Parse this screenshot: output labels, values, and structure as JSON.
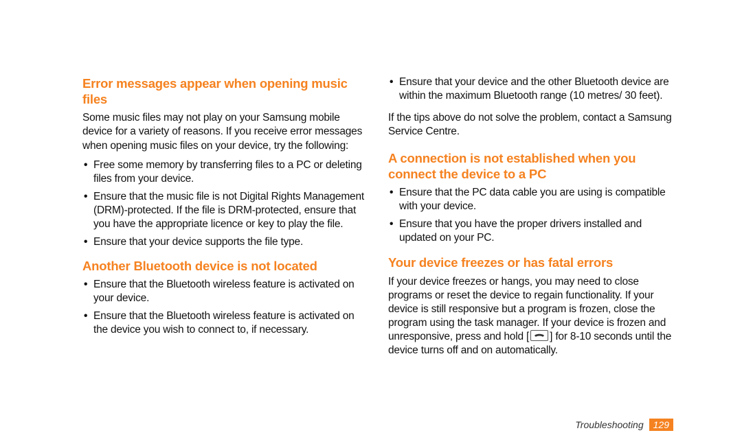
{
  "left": {
    "h1": "Error messages appear when opening music files",
    "p1": "Some music files may not play on your Samsung mobile device for a variety of reasons. If you receive error messages when opening music files on your device, try the following:",
    "list1": [
      "Free some memory by transferring files to a PC or deleting files from your device.",
      "Ensure that the music file is not Digital Rights Management (DRM)-protected. If the file is DRM-protected, ensure that you have the appropriate licence or key to play the file.",
      "Ensure that your device supports the file type."
    ],
    "h2": "Another Bluetooth device is not located",
    "list2": [
      "Ensure that the Bluetooth wireless feature is activated on your device.",
      "Ensure that the Bluetooth wireless feature is activated on the device you wish to connect to, if necessary."
    ]
  },
  "right": {
    "list1": [
      "Ensure that your device and the other Bluetooth device are within the maximum Bluetooth range (10 metres/ 30 feet)."
    ],
    "p1": "If the tips above do not solve the problem, contact a Samsung Service Centre.",
    "h1": "A connection is not established when you connect the device to a PC",
    "list2": [
      "Ensure that the PC data cable you are using is compatible with your device.",
      "Ensure that you have the proper drivers installed and updated on your PC."
    ],
    "h2": "Your device freezes or has fatal errors",
    "p2_before": "If your device freezes or hangs, you may need to close programs or reset the device to regain functionality. If your device is still responsive but a program is frozen, close the program using the task manager. If your device is frozen and unresponsive, press and hold [",
    "p2_after": "] for 8-10 seconds until the device turns off and on automatically."
  },
  "footer": {
    "section": "Troubleshooting",
    "page": "129"
  }
}
